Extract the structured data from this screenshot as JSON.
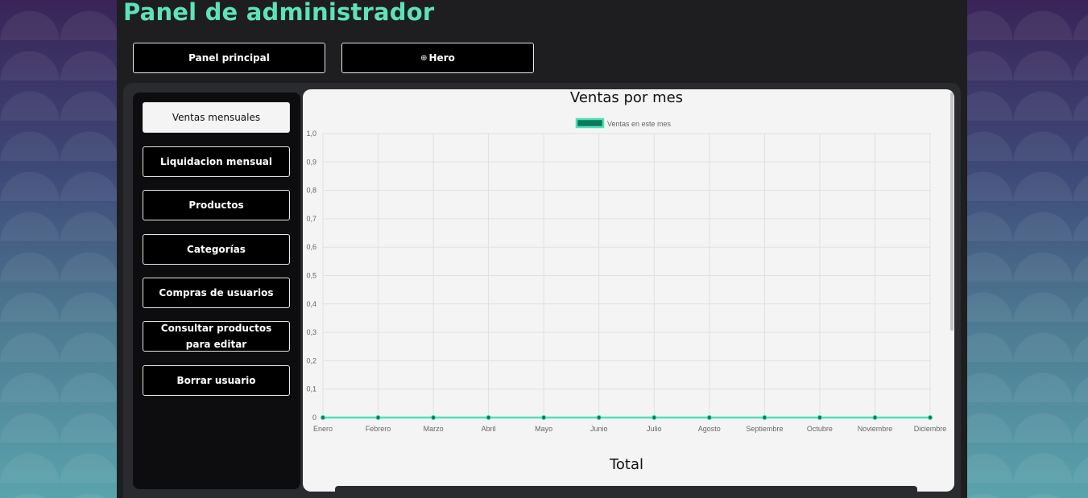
{
  "page": {
    "title": "Panel de administrador"
  },
  "top_nav": {
    "panel_principal": "Panel principal",
    "hero_icon": "plus-icon",
    "hero_icon_glyph": "⊕",
    "hero": "Hero"
  },
  "sidebar": {
    "items": [
      {
        "label": "Ventas mensuales",
        "active": true
      },
      {
        "label": "Liquidacion mensual",
        "active": false
      },
      {
        "label": "Productos",
        "active": false
      },
      {
        "label": "Categorías",
        "active": false
      },
      {
        "label": "Compras de usuarios",
        "active": false
      },
      {
        "label": "Consultar productos para editar",
        "active": false
      },
      {
        "label": "Borrar usuario",
        "active": false
      }
    ]
  },
  "colors": {
    "accent": "#5ee2b8",
    "line": "#4fe0b6",
    "point": "#0a7a5c",
    "legend_fill": "#0a7a5c",
    "legend_border": "#4fe0b6"
  },
  "total": {
    "title": "Total"
  },
  "chart_data": {
    "type": "line",
    "title": "Ventas por mes",
    "categories": [
      "Enero",
      "Febrero",
      "Marzo",
      "Abril",
      "Mayo",
      "Junio",
      "Julio",
      "Agosto",
      "Septiembre",
      "Octubre",
      "Noviembre",
      "Diciembre"
    ],
    "series": [
      {
        "name": "Ventas en este mes",
        "values": [
          0,
          0,
          0,
          0,
          0,
          0,
          0,
          0,
          0,
          0,
          0,
          0
        ]
      }
    ],
    "yticks": [
      "0",
      "0,1",
      "0,2",
      "0,3",
      "0,4",
      "0,5",
      "0,6",
      "0,7",
      "0,8",
      "0,9",
      "1,0"
    ],
    "ylim": [
      0,
      1
    ],
    "grid": true,
    "legend_position": "top-center"
  }
}
